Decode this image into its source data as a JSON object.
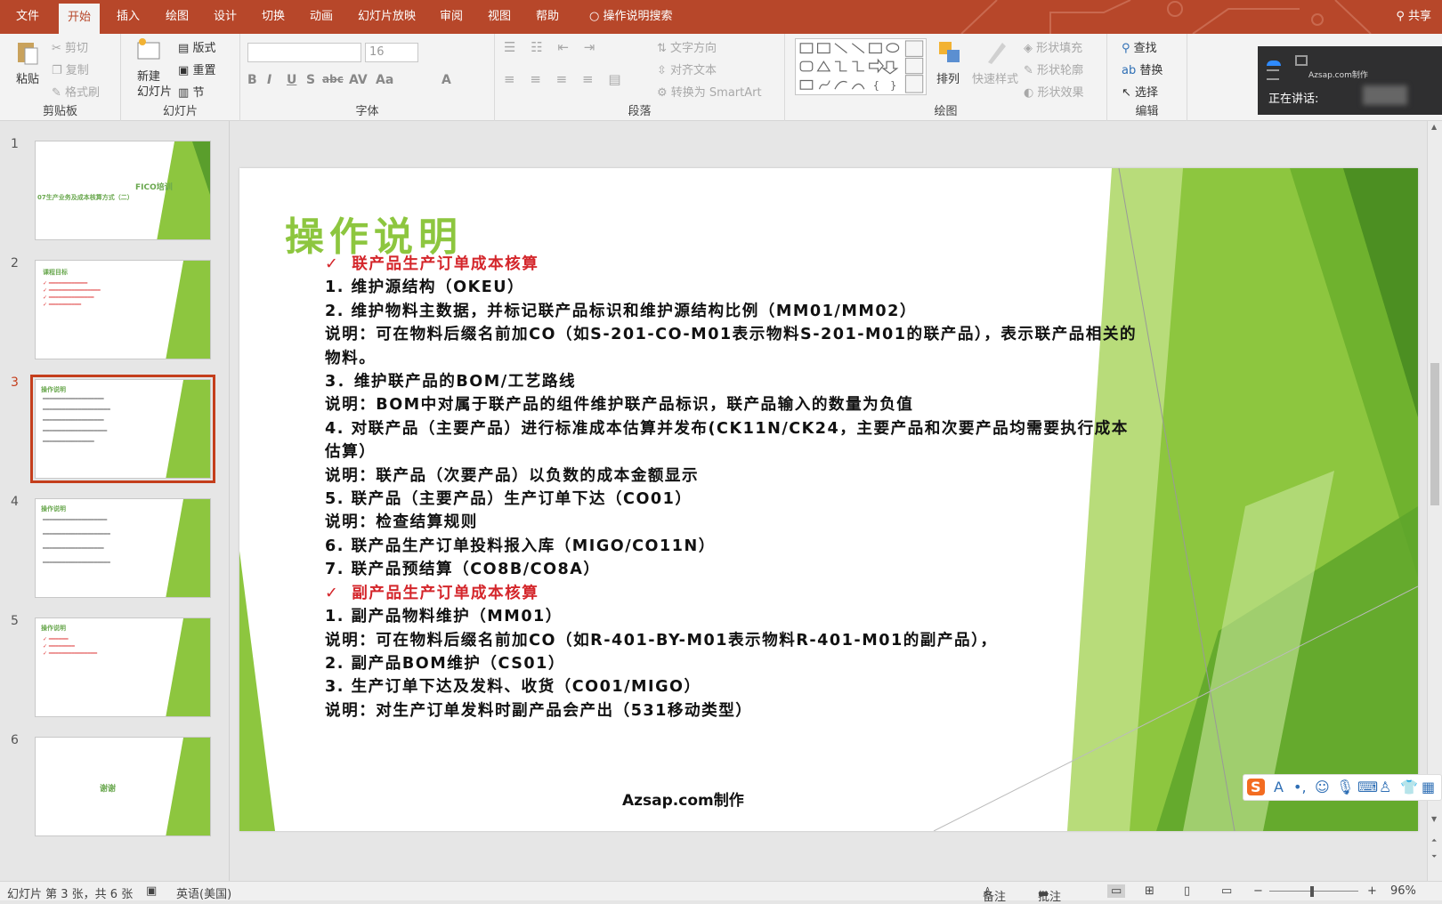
{
  "tabs": [
    "文件",
    "开始",
    "插入",
    "绘图",
    "设计",
    "切换",
    "动画",
    "幻灯片放映",
    "审阅",
    "视图",
    "帮助"
  ],
  "tell_me": "操作说明搜索",
  "share": "共享",
  "ribbon": {
    "clipboard": {
      "label": "剪贴板",
      "paste": "粘贴",
      "cut": "剪切",
      "copy": "复制",
      "format_painter": "格式刷"
    },
    "slides": {
      "label": "幻灯片",
      "new_slide": "新建\n幻灯片",
      "layout": "版式",
      "reset": "重置",
      "section": "节"
    },
    "font": {
      "label": "字体",
      "size": "16",
      "buttons": [
        "B",
        "I",
        "U",
        "S",
        "abc",
        "AV",
        "Aa",
        "A"
      ]
    },
    "paragraph": {
      "label": "段落",
      "text_direction": "文字方向",
      "align_text": "对齐文本",
      "convert_smartart": "转换为 SmartArt"
    },
    "drawing": {
      "label": "绘图",
      "arrange": "排列",
      "quick_styles": "快速样式",
      "shape_fill": "形状填充",
      "shape_outline": "形状轮廓",
      "shape_effects": "形状效果"
    },
    "editing": {
      "label": "编辑",
      "find": "查找",
      "replace": "替换",
      "select": "选择"
    }
  },
  "speaker_panel": {
    "brand": "Azsap.com制作",
    "speaking": "正在讲话:"
  },
  "thumbnails": [
    {
      "num": "1",
      "title": "FICO培训",
      "sub": "07生产业务及成本核算方式（二）"
    },
    {
      "num": "2",
      "title": "课程目标"
    },
    {
      "num": "3",
      "title": "操作说明"
    },
    {
      "num": "4",
      "title": "操作说明"
    },
    {
      "num": "5",
      "title": "操作说明"
    },
    {
      "num": "6",
      "title": "谢谢"
    }
  ],
  "slide": {
    "title": "操作说明",
    "lines": [
      {
        "type": "head",
        "text": "联产品生产订单成本核算"
      },
      {
        "type": "text",
        "text": "1.  维护源结构（OKEU）"
      },
      {
        "type": "text",
        "text": "2.  维护物料主数据，并标记联产品标识和维护源结构比例（MM01/MM02）"
      },
      {
        "type": "text",
        "text": "说明：可在物料后缀名前加CO（如S-201-CO-M01表示物料S-201-M01的联产品），表示联产品相关的物料。"
      },
      {
        "type": "text",
        "text": "3．维护联产品的BOM/工艺路线"
      },
      {
        "type": "text",
        "text": "说明：BOM中对属于联产品的组件维护联产品标识，联产品输入的数量为负值"
      },
      {
        "type": "text",
        "text": "4. 对联产品（主要产品）进行标准成本估算并发布(CK11N/CK24，主要产品和次要产品均需要执行成本估算）"
      },
      {
        "type": "text",
        "text": "说明：联产品（次要产品）以负数的成本金额显示"
      },
      {
        "type": "text",
        "text": "5. 联产品（主要产品）生产订单下达（CO01）"
      },
      {
        "type": "text",
        "text": "说明：检查结算规则"
      },
      {
        "type": "text",
        "text": "6. 联产品生产订单投料报入库（MIGO/CO11N）"
      },
      {
        "type": "text",
        "text": "7. 联产品预结算（CO8B/CO8A）"
      },
      {
        "type": "head",
        "text": "副产品生产订单成本核算"
      },
      {
        "type": "text",
        "text": "1.  副产品物料维护（MM01）"
      },
      {
        "type": "text",
        "text": "说明：可在物料后缀名前加CO（如R-401-BY-M01表示物料R-401-M01的副产品），"
      },
      {
        "type": "text",
        "text": "2. 副产品BOM维护（CS01）"
      },
      {
        "type": "text",
        "text": "3. 生产订单下达及发料、收货（CO01/MIGO）"
      },
      {
        "type": "text",
        "text": "说明：对生产订单发料时副产品会产出（531移动类型）"
      }
    ],
    "footer": "Azsap.com制作"
  },
  "status": {
    "slide_info": "幻灯片 第 3 张，共 6 张",
    "language": "英语(美国)",
    "notes": "备注",
    "comments": "批注",
    "zoom": "96%"
  }
}
